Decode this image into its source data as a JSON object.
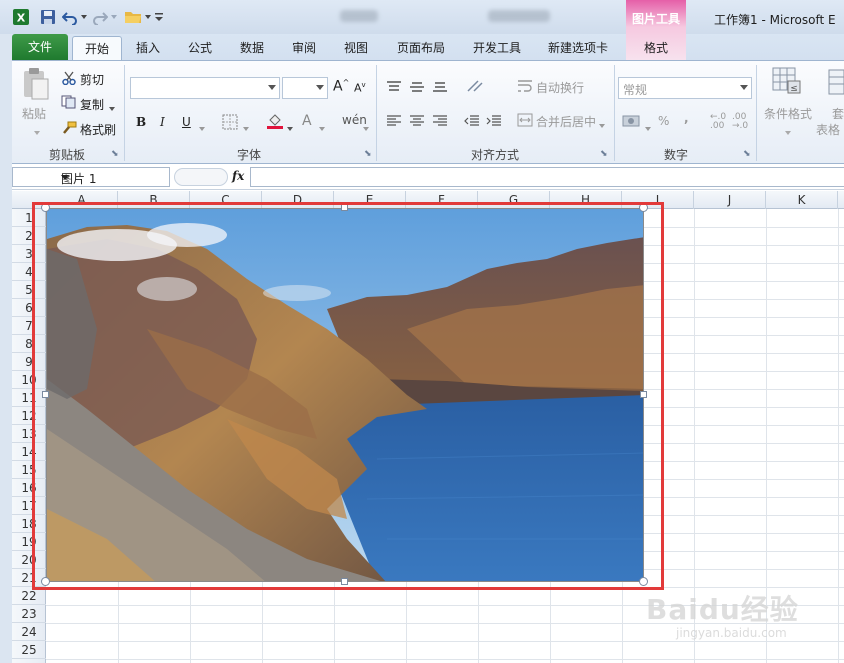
{
  "window": {
    "title": "工作簿1 - Microsoft E"
  },
  "contextual_tab": {
    "group_label": "图片工具",
    "tab_label": "格式"
  },
  "tabs": [
    {
      "label": "文件",
      "active": false
    },
    {
      "label": "开始",
      "active": true
    },
    {
      "label": "插入"
    },
    {
      "label": "公式"
    },
    {
      "label": "数据"
    },
    {
      "label": "审阅"
    },
    {
      "label": "视图"
    },
    {
      "label": "页面布局"
    },
    {
      "label": "开发工具"
    },
    {
      "label": "新建选项卡"
    }
  ],
  "ribbon": {
    "clipboard": {
      "paste": "粘贴",
      "cut": "剪切",
      "copy": "复制",
      "format_painter": "格式刷",
      "group": "剪贴板"
    },
    "font": {
      "group": "字体",
      "font_name": "",
      "font_size": ""
    },
    "alignment": {
      "wrap_text": "自动换行",
      "merge_center": "合并后居中",
      "group": "对齐方式"
    },
    "number": {
      "format": "常规",
      "group": "数字"
    },
    "styles": {
      "conditional_format": "条件格式",
      "table_format_1": "套",
      "table_format_2": "表格"
    }
  },
  "formula_bar": {
    "name_box": "图片 1",
    "fx": "fx",
    "content": ""
  },
  "grid": {
    "columns": [
      "A",
      "B",
      "C",
      "D",
      "E",
      "F",
      "G",
      "H",
      "I",
      "J",
      "K"
    ],
    "rows": [
      "1",
      "2",
      "3",
      "4",
      "5",
      "6",
      "7",
      "8",
      "9",
      "10",
      "11",
      "12",
      "13",
      "14",
      "15",
      "16",
      "17",
      "18",
      "19",
      "20",
      "21",
      "22",
      "23",
      "24",
      "25"
    ]
  },
  "picture": {
    "description_icon": "landscape-photo"
  },
  "watermark": {
    "brand": "Baidu经验",
    "url": "jingyan.baidu.com"
  },
  "colors": {
    "file_tab": "#2e8b3e",
    "picture_tools": "#e0559e",
    "selection_frame": "#e23a3a",
    "lake": "#2f63a8",
    "sky": "#8fc0ea"
  }
}
